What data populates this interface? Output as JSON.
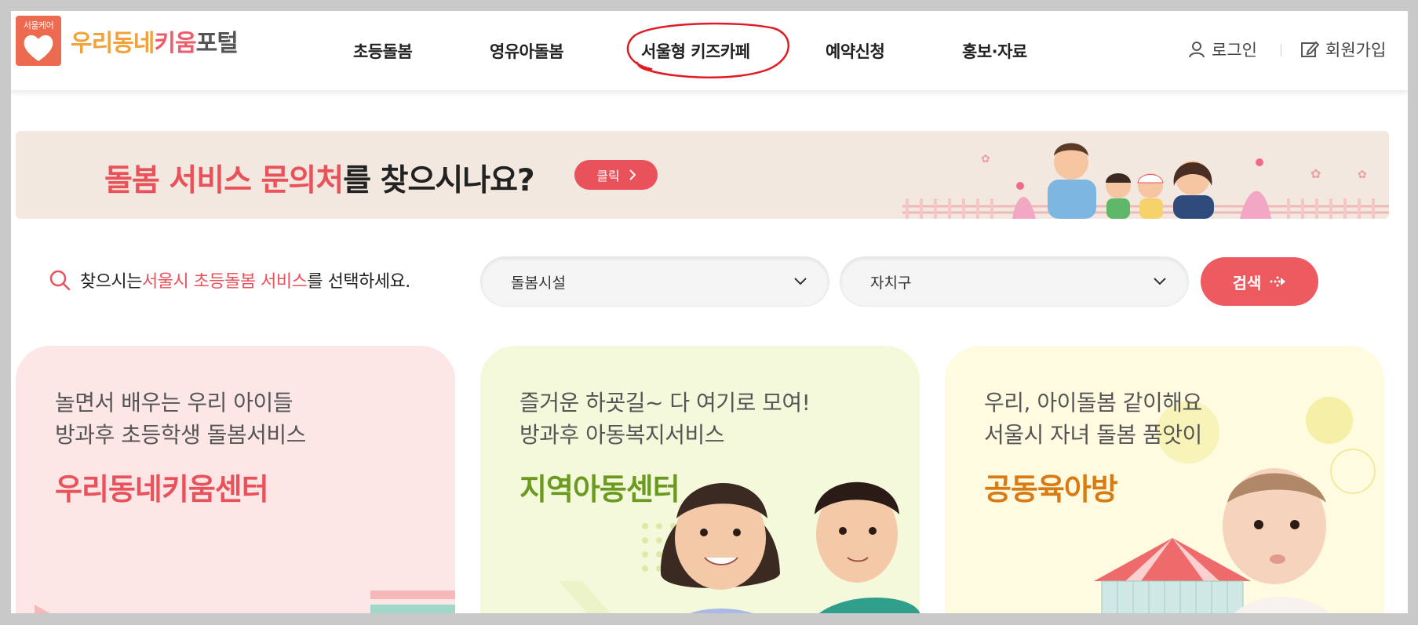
{
  "header": {
    "logo_badge": "서울케어",
    "logo_text_1": "우리동네",
    "logo_text_2": "키움",
    "logo_text_3": "포털",
    "nav": [
      {
        "label": "초등돌봄"
      },
      {
        "label": "영유아돌봄"
      },
      {
        "label": "서울형 키즈카페"
      },
      {
        "label": "예약신청"
      },
      {
        "label": "홍보·자료"
      }
    ],
    "login_label": "로그인",
    "signup_label": "회원가입"
  },
  "banner": {
    "title_highlight": "돌봄 서비스 문의처",
    "title_rest": "를 찾으시나요?",
    "button_label": "클릭"
  },
  "search": {
    "label_pre": "찾으시는 ",
    "label_highlight": "서울시 초등돌봄 서비스",
    "label_post": "를 선택하세요.",
    "facility_value": "돌봄시설",
    "district_value": "자치구",
    "button_label": "검색"
  },
  "cards": [
    {
      "line1": "놀면서 배우는 우리 아이들",
      "line2": "방과후 초등학생 돌봄서비스",
      "title": "우리동네키움센터"
    },
    {
      "line1": "즐거운 하굣길~ 다 여기로 모여!",
      "line2": "방과후 아동복지서비스",
      "title": "지역아동센터"
    },
    {
      "line1": "우리, 아이돌봄 같이해요",
      "line2": "서울시 자녀 돌봄 품앗이",
      "title": "공동육아방"
    }
  ],
  "colors": {
    "accent": "#e9525a",
    "logo_orange": "#f2a23a",
    "green_title": "#6a9a1f",
    "orange_title": "#d97b12"
  }
}
